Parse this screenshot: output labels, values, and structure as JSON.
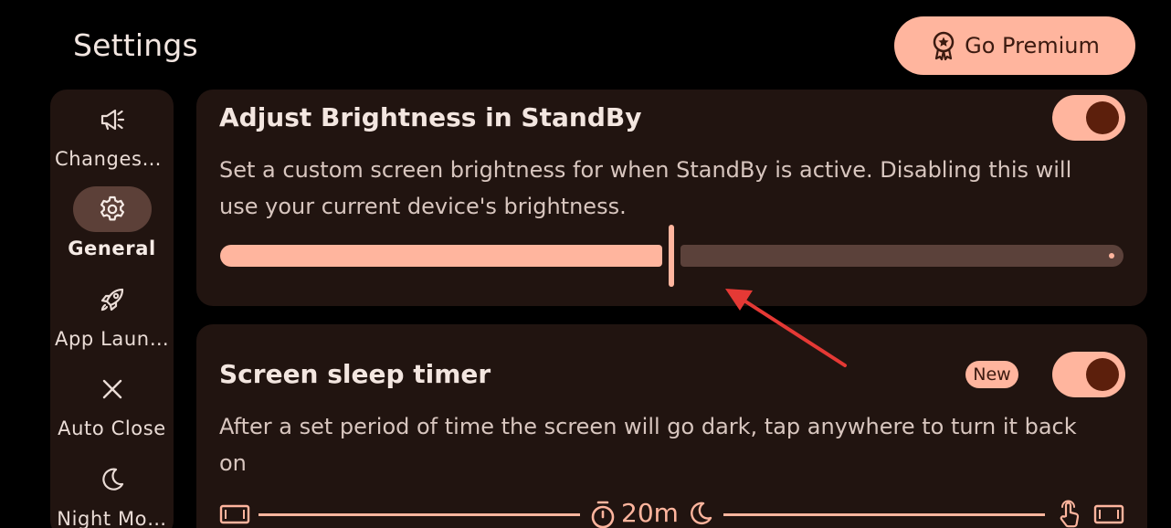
{
  "header": {
    "title": "Settings",
    "premium_label": "Go Premium"
  },
  "sidebar": {
    "items": [
      {
        "label": "Changes[…",
        "icon": "megaphone-icon",
        "active": false
      },
      {
        "label": "General",
        "icon": "gear-icon",
        "active": true
      },
      {
        "label": "App Laun…",
        "icon": "rocket-icon",
        "active": false
      },
      {
        "label": "Auto Close",
        "icon": "close-icon",
        "active": false
      },
      {
        "label": "Night Mo…",
        "icon": "moon-icon",
        "active": false
      }
    ]
  },
  "brightness_card": {
    "title": "Adjust Brightness in StandBy",
    "description": "Set a custom screen brightness for when StandBy is active. Disabling this will use your current device's brightness.",
    "toggle_on": true,
    "slider_value": 0.5
  },
  "sleep_card": {
    "title": "Screen sleep timer",
    "badge": "New",
    "description": "After a set period of time the screen will go dark, tap anywhere to turn it back on",
    "toggle_on": true,
    "timer_value": "20m"
  },
  "colors": {
    "accent": "#ffb59e",
    "background": "#000000",
    "surface": "#211410",
    "annotation": "#e53935"
  }
}
